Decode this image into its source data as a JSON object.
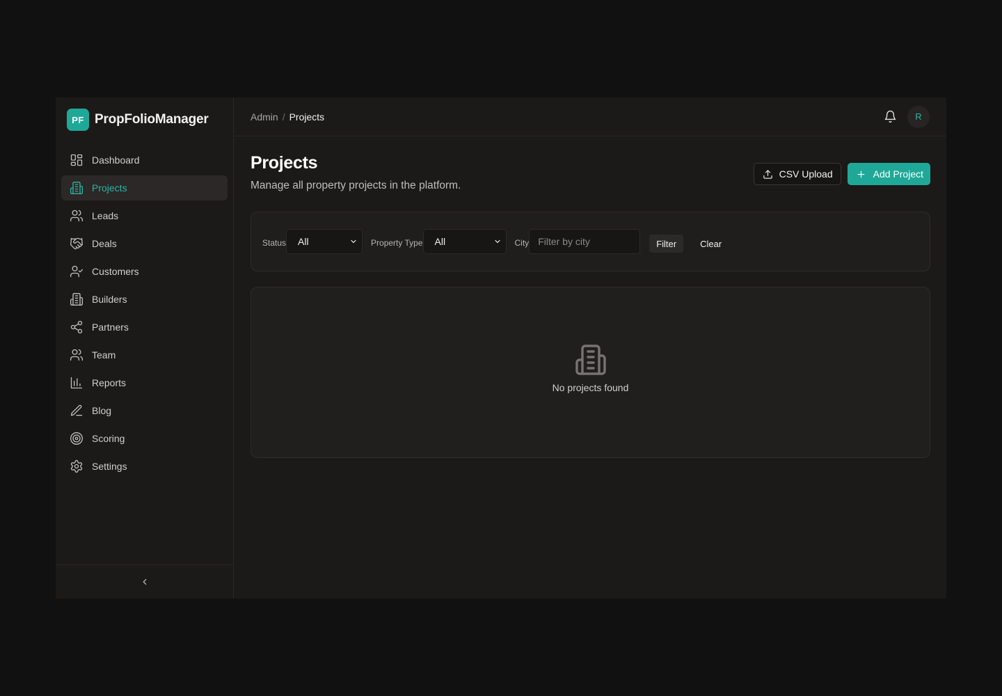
{
  "brand": {
    "logo_text": "PF",
    "name": "PropFolioManager",
    "accent": "#1fa898"
  },
  "sidebar": {
    "items": [
      {
        "label": "Dashboard",
        "icon": "dashboard-icon",
        "active": false
      },
      {
        "label": "Projects",
        "icon": "building-icon",
        "active": true
      },
      {
        "label": "Leads",
        "icon": "users-icon",
        "active": false
      },
      {
        "label": "Deals",
        "icon": "handshake-icon",
        "active": false
      },
      {
        "label": "Customers",
        "icon": "user-check-icon",
        "active": false
      },
      {
        "label": "Builders",
        "icon": "building-icon",
        "active": false
      },
      {
        "label": "Partners",
        "icon": "share-icon",
        "active": false
      },
      {
        "label": "Team",
        "icon": "users-icon",
        "active": false
      },
      {
        "label": "Reports",
        "icon": "bar-chart-icon",
        "active": false
      },
      {
        "label": "Blog",
        "icon": "pen-icon",
        "active": false
      },
      {
        "label": "Scoring",
        "icon": "target-icon",
        "active": false
      },
      {
        "label": "Settings",
        "icon": "gear-icon",
        "active": false
      }
    ],
    "collapse_icon": "chevron-left-icon"
  },
  "topbar": {
    "breadcrumb": {
      "parent": "Admin",
      "separator": "/",
      "current": "Projects"
    },
    "avatar_initial": "R"
  },
  "page": {
    "title": "Projects",
    "subtitle": "Manage all property projects in the platform.",
    "csv_upload_label": "CSV Upload",
    "add_project_label": "Add Project"
  },
  "filters": {
    "status_label": "Status",
    "status_value": "All",
    "property_type_label": "Property Type",
    "property_type_value": "All",
    "city_label": "City",
    "city_placeholder": "Filter by city",
    "filter_label": "Filter",
    "clear_label": "Clear"
  },
  "empty_state": {
    "icon": "building-icon",
    "message": "No projects found"
  }
}
